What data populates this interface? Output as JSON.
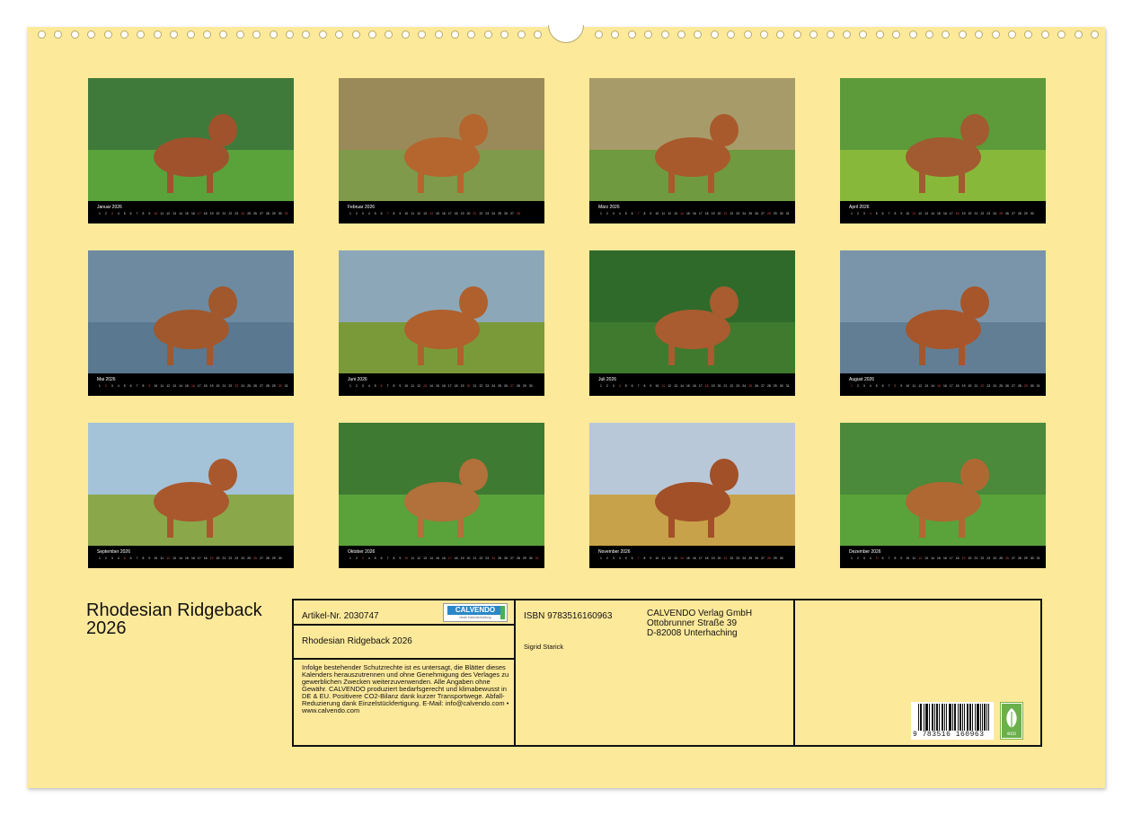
{
  "calendar": {
    "title": "Rhodesian Ridgeback 2026",
    "months": [
      {
        "name": "Januar",
        "start": 4,
        "days": 31
      },
      {
        "name": "Februar",
        "start": 0,
        "days": 28
      },
      {
        "name": "März",
        "start": 0,
        "days": 31
      },
      {
        "name": "April",
        "start": 3,
        "days": 30
      },
      {
        "name": "Mai",
        "start": 5,
        "days": 31
      },
      {
        "name": "Juni",
        "start": 1,
        "days": 30
      },
      {
        "name": "Juli",
        "start": 3,
        "days": 31
      },
      {
        "name": "August",
        "start": 6,
        "days": 31
      },
      {
        "name": "September",
        "start": 2,
        "days": 30
      },
      {
        "name": "Oktober",
        "start": 4,
        "days": 31
      },
      {
        "name": "November",
        "start": 0,
        "days": 30
      },
      {
        "name": "Dezember",
        "start": 2,
        "days": 31
      }
    ],
    "year": "2026"
  },
  "info": {
    "article_no": "Artikel-Nr. 2030747",
    "product_title": "Rhodesian Ridgeback 2026",
    "legal_text": "Infolge bestehender Schutzrechte ist es untersagt, die Blätter dieses Kalenders herauszutrennen und ohne Genehmigung des Verlages zu gewerblichen Zwecken weiterzuverwenden. Alle Angaben ohne Gewähr. CALVENDO produziert bedarfsgerecht und klimabewusst in DE & EU. Positivere CO2-Bilanz dank kurzer Transportwege. Abfall-Reduzierung dank Einzelstückfertigung. E-Mail: info@calvendo.com • www.calvendo.com",
    "isbn": "ISBN 9783516160963",
    "author": "Sigrid Starick",
    "publisher_lines": [
      "CALVENDO Verlag GmbH",
      "Ottobrunner Straße 39",
      "D-82008 Unterhaching"
    ],
    "logo": {
      "brand": "CALVENDO",
      "tagline": "beste Kalenderhaltung"
    },
    "barcode_digits": "9 783516 160963",
    "eco_label": "eco"
  }
}
